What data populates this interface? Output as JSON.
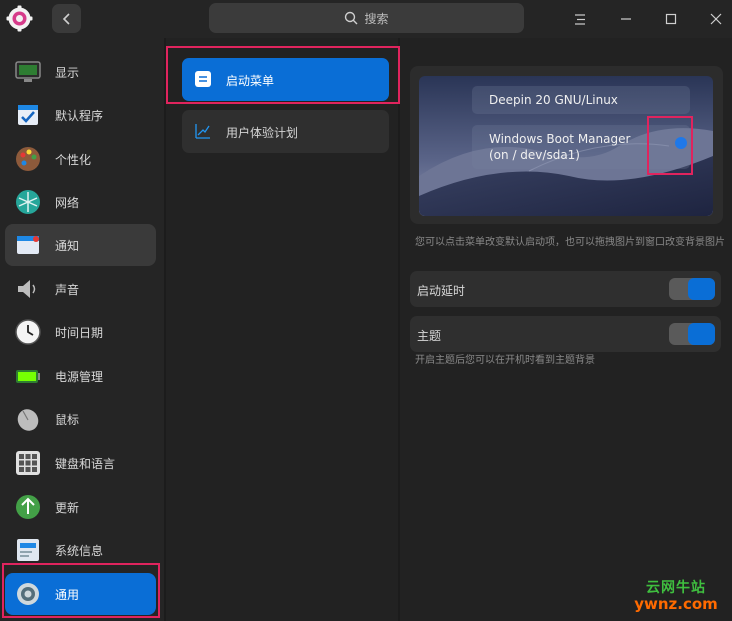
{
  "titlebar": {
    "app_icon": "settings-gear-icon",
    "back_icon": "chevron-left-icon",
    "search_placeholder": "搜索",
    "menu_icon": "menu-icon",
    "minimize_icon": "minimize-icon",
    "maximize_icon": "maximize-icon",
    "close_icon": "close-icon"
  },
  "sidebar": {
    "items": [
      {
        "label": "显示",
        "icon": "display-icon"
      },
      {
        "label": "默认程序",
        "icon": "default-apps-icon"
      },
      {
        "label": "个性化",
        "icon": "personalization-icon"
      },
      {
        "label": "网络",
        "icon": "network-icon"
      },
      {
        "label": "通知",
        "icon": "notification-icon"
      },
      {
        "label": "声音",
        "icon": "sound-icon"
      },
      {
        "label": "时间日期",
        "icon": "clock-icon"
      },
      {
        "label": "电源管理",
        "icon": "battery-icon"
      },
      {
        "label": "鼠标",
        "icon": "mouse-icon"
      },
      {
        "label": "键盘和语言",
        "icon": "keyboard-icon"
      },
      {
        "label": "更新",
        "icon": "update-icon"
      },
      {
        "label": "系统信息",
        "icon": "system-info-icon"
      },
      {
        "label": "通用",
        "icon": "general-icon"
      }
    ],
    "active_index": 12,
    "hover_index": 4
  },
  "submenu": {
    "items": [
      {
        "label": "启动菜单",
        "icon": "boot-menu-icon"
      },
      {
        "label": "用户体验计划",
        "icon": "chart-icon"
      }
    ],
    "active_index": 0
  },
  "boot": {
    "entries": [
      "Deepin 20 GNU/Linux",
      "Windows Boot Manager (on / dev/sda1)"
    ],
    "hint": "您可以点击菜单改变默认启动项，也可以拖拽图片到窗口改变背景图片",
    "delay_label": "启动延时",
    "delay_enabled": true,
    "theme_label": "主题",
    "theme_enabled": true,
    "theme_hint": "开启主题后您可以在开机时看到主题背景"
  },
  "colors": {
    "accent": "#0a6ed6",
    "highlight_box": "#e0245e"
  },
  "watermark": {
    "line1": "云网牛站",
    "line2": "ywnz.com"
  }
}
